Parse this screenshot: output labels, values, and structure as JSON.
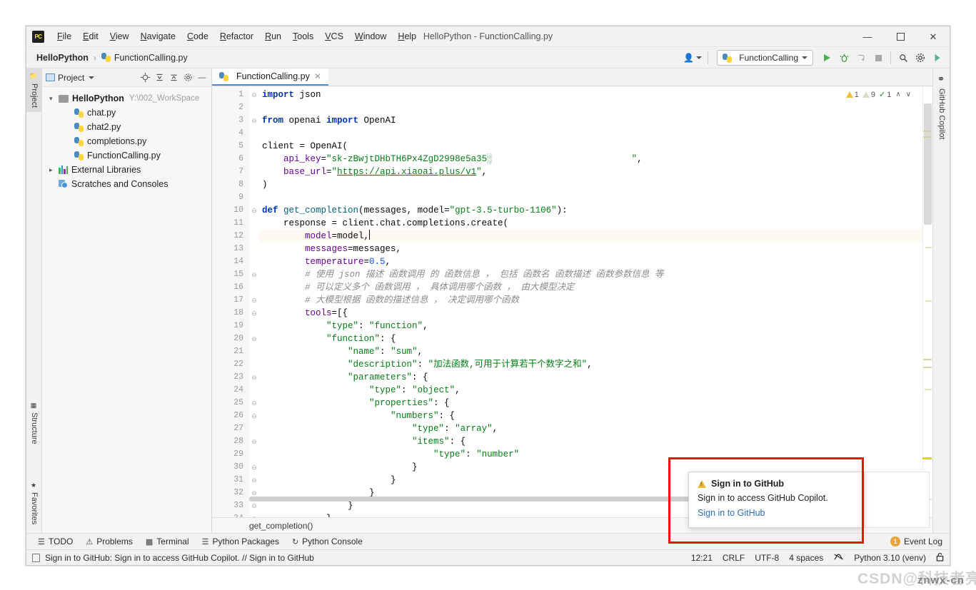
{
  "window": {
    "title": "HelloPython - FunctionCalling.py",
    "minimize": "—",
    "maximize": "❐",
    "close": "✕"
  },
  "menubar": {
    "logo": "PC",
    "items": [
      "File",
      "Edit",
      "View",
      "Navigate",
      "Code",
      "Refactor",
      "Run",
      "Tools",
      "VCS",
      "Window",
      "Help"
    ]
  },
  "breadcrumb": {
    "project": "HelloPython",
    "separator": "›",
    "file": "FunctionCalling.py"
  },
  "toolbar": {
    "account_icon": "person-icon",
    "run_config": "FunctionCalling",
    "run": "run-icon",
    "debug": "debug-icon",
    "coverage": "coverage-icon",
    "stop": "stop-icon",
    "search": "⚲",
    "settings": "⚙",
    "updates": "◖"
  },
  "left_strip": {
    "project": "Project",
    "structure": "Structure",
    "favorites": "Favorites"
  },
  "right_strip": {
    "copilot": "GitHub Copilot"
  },
  "project_panel": {
    "title": "Project",
    "icons": [
      "locate-icon",
      "expand-all-icon",
      "collapse-all-icon",
      "gear-icon",
      "hide-icon"
    ],
    "tree": [
      {
        "label": "HelloPython",
        "path": "Y:\\002_WorkSpace",
        "type": "folder",
        "indent": 0,
        "expanded": true,
        "bold": true
      },
      {
        "label": "chat.py",
        "path": "",
        "type": "py",
        "indent": 1,
        "expanded": null,
        "bold": false
      },
      {
        "label": "chat2.py",
        "path": "",
        "type": "py",
        "indent": 1,
        "expanded": null,
        "bold": false
      },
      {
        "label": "completions.py",
        "path": "",
        "type": "py",
        "indent": 1,
        "expanded": null,
        "bold": false
      },
      {
        "label": "FunctionCalling.py",
        "path": "",
        "type": "py",
        "indent": 1,
        "expanded": null,
        "bold": false
      },
      {
        "label": "External Libraries",
        "path": "",
        "type": "lib",
        "indent": 0,
        "expanded": false,
        "bold": false
      },
      {
        "label": "Scratches and Consoles",
        "path": "",
        "type": "scratch",
        "indent": 0,
        "expanded": null,
        "bold": false
      }
    ]
  },
  "editor": {
    "tab": {
      "label": "FunctionCalling.py",
      "close": "✕"
    },
    "inspections": {
      "warnings": "1",
      "weak_warnings": "9",
      "checks": "1",
      "up": "∧",
      "down": "∨"
    },
    "caret_line": 12,
    "breadcrumb": "get_completion()",
    "lines": [
      {
        "n": 1,
        "fold": "⊖",
        "tokens": [
          {
            "t": "import",
            "c": "kw"
          },
          {
            "t": " json",
            "c": ""
          }
        ]
      },
      {
        "n": 2,
        "fold": "",
        "tokens": []
      },
      {
        "n": 3,
        "fold": "⊖",
        "tokens": [
          {
            "t": "from",
            "c": "kw"
          },
          {
            "t": " openai ",
            "c": ""
          },
          {
            "t": "import",
            "c": "kw"
          },
          {
            "t": " OpenAI",
            "c": ""
          }
        ]
      },
      {
        "n": 4,
        "fold": "",
        "tokens": []
      },
      {
        "n": 5,
        "fold": "",
        "tokens": [
          {
            "t": "client = OpenAI(",
            "c": ""
          }
        ]
      },
      {
        "n": 6,
        "fold": "",
        "tokens": [
          {
            "t": "    ",
            "c": ""
          },
          {
            "t": "api_key",
            "c": "param"
          },
          {
            "t": "=",
            "c": ""
          },
          {
            "t": "\"sk-zBwjtDHbTH6Px4ZgD2998e5a35░",
            "c": "str"
          },
          {
            "t": "                          \"",
            "c": "str"
          },
          {
            "t": ",",
            "c": ""
          }
        ]
      },
      {
        "n": 7,
        "fold": "",
        "tokens": [
          {
            "t": "    ",
            "c": ""
          },
          {
            "t": "base_url",
            "c": "param"
          },
          {
            "t": "=",
            "c": ""
          },
          {
            "t": "\"",
            "c": "str"
          },
          {
            "t": "https://api.xiaoai.plus/v1",
            "c": "link"
          },
          {
            "t": "\"",
            "c": "str"
          },
          {
            "t": ",",
            "c": ""
          }
        ]
      },
      {
        "n": 8,
        "fold": "",
        "tokens": [
          {
            "t": ")",
            "c": ""
          }
        ]
      },
      {
        "n": 9,
        "fold": "",
        "tokens": []
      },
      {
        "n": 10,
        "fold": "⊖",
        "tokens": [
          {
            "t": "def",
            "c": "kw"
          },
          {
            "t": " ",
            "c": ""
          },
          {
            "t": "get_completion",
            "c": "fn"
          },
          {
            "t": "(messages, model=",
            "c": ""
          },
          {
            "t": "\"gpt-3.5-turbo-1106\"",
            "c": "str"
          },
          {
            "t": "):",
            "c": ""
          }
        ]
      },
      {
        "n": 11,
        "fold": "",
        "tokens": [
          {
            "t": "    response = client.chat.completions.create(",
            "c": ""
          }
        ]
      },
      {
        "n": 12,
        "fold": "",
        "tokens": [
          {
            "t": "        ",
            "c": ""
          },
          {
            "t": "model",
            "c": "param"
          },
          {
            "t": "=model,",
            "c": ""
          },
          {
            "t": "|",
            "c": "caret"
          }
        ]
      },
      {
        "n": 13,
        "fold": "",
        "tokens": [
          {
            "t": "        ",
            "c": ""
          },
          {
            "t": "messages",
            "c": "param"
          },
          {
            "t": "=messages,",
            "c": ""
          }
        ]
      },
      {
        "n": 14,
        "fold": "",
        "tokens": [
          {
            "t": "        ",
            "c": ""
          },
          {
            "t": "temperature",
            "c": "param"
          },
          {
            "t": "=",
            "c": ""
          },
          {
            "t": "0.5",
            "c": "num"
          },
          {
            "t": ",",
            "c": ""
          }
        ]
      },
      {
        "n": 15,
        "fold": "⊖",
        "tokens": [
          {
            "t": "        # 使用 json 描述 函数调用 的 函数信息 ， 包括 函数名 函数描述 函数参数信息 等",
            "c": "cmt"
          }
        ]
      },
      {
        "n": 16,
        "fold": "",
        "tokens": [
          {
            "t": "        # 可以定义多个 函数调用 ， 具体调用哪个函数 ， 由大模型决定",
            "c": "cmt"
          }
        ]
      },
      {
        "n": 17,
        "fold": "⊖",
        "tokens": [
          {
            "t": "        # 大模型根据 函数的描述信息 ， 决定调用哪个函数",
            "c": "cmt"
          }
        ]
      },
      {
        "n": 18,
        "fold": "⊖",
        "tokens": [
          {
            "t": "        ",
            "c": ""
          },
          {
            "t": "tools",
            "c": "param"
          },
          {
            "t": "=[{",
            "c": ""
          }
        ]
      },
      {
        "n": 19,
        "fold": "",
        "tokens": [
          {
            "t": "            ",
            "c": ""
          },
          {
            "t": "\"type\"",
            "c": "str"
          },
          {
            "t": ": ",
            "c": ""
          },
          {
            "t": "\"function\"",
            "c": "str"
          },
          {
            "t": ",",
            "c": ""
          }
        ]
      },
      {
        "n": 20,
        "fold": "⊖",
        "tokens": [
          {
            "t": "            ",
            "c": ""
          },
          {
            "t": "\"function\"",
            "c": "str"
          },
          {
            "t": ": {",
            "c": ""
          }
        ]
      },
      {
        "n": 21,
        "fold": "",
        "tokens": [
          {
            "t": "                ",
            "c": ""
          },
          {
            "t": "\"name\"",
            "c": "str"
          },
          {
            "t": ": ",
            "c": ""
          },
          {
            "t": "\"sum\"",
            "c": "str"
          },
          {
            "t": ",",
            "c": ""
          }
        ]
      },
      {
        "n": 22,
        "fold": "",
        "tokens": [
          {
            "t": "                ",
            "c": ""
          },
          {
            "t": "\"description\"",
            "c": "str"
          },
          {
            "t": ": ",
            "c": ""
          },
          {
            "t": "\"加法函数,可用于计算若干个数字之和\"",
            "c": "str"
          },
          {
            "t": ",",
            "c": ""
          }
        ]
      },
      {
        "n": 23,
        "fold": "⊖",
        "tokens": [
          {
            "t": "                ",
            "c": ""
          },
          {
            "t": "\"parameters\"",
            "c": "str"
          },
          {
            "t": ": {",
            "c": ""
          }
        ]
      },
      {
        "n": 24,
        "fold": "",
        "tokens": [
          {
            "t": "                    ",
            "c": ""
          },
          {
            "t": "\"type\"",
            "c": "str"
          },
          {
            "t": ": ",
            "c": ""
          },
          {
            "t": "\"object\"",
            "c": "str"
          },
          {
            "t": ",",
            "c": ""
          }
        ]
      },
      {
        "n": 25,
        "fold": "⊖",
        "tokens": [
          {
            "t": "                    ",
            "c": ""
          },
          {
            "t": "\"properties\"",
            "c": "str"
          },
          {
            "t": ": {",
            "c": ""
          }
        ]
      },
      {
        "n": 26,
        "fold": "⊖",
        "tokens": [
          {
            "t": "                        ",
            "c": ""
          },
          {
            "t": "\"numbers\"",
            "c": "str"
          },
          {
            "t": ": {",
            "c": ""
          }
        ]
      },
      {
        "n": 27,
        "fold": "",
        "tokens": [
          {
            "t": "                            ",
            "c": ""
          },
          {
            "t": "\"type\"",
            "c": "str"
          },
          {
            "t": ": ",
            "c": ""
          },
          {
            "t": "\"array\"",
            "c": "str"
          },
          {
            "t": ",",
            "c": ""
          }
        ]
      },
      {
        "n": 28,
        "fold": "⊖",
        "tokens": [
          {
            "t": "                            ",
            "c": ""
          },
          {
            "t": "\"items\"",
            "c": "str"
          },
          {
            "t": ": {",
            "c": ""
          }
        ]
      },
      {
        "n": 29,
        "fold": "",
        "tokens": [
          {
            "t": "                                ",
            "c": ""
          },
          {
            "t": "\"type\"",
            "c": "str"
          },
          {
            "t": ": ",
            "c": ""
          },
          {
            "t": "\"number\"",
            "c": "str"
          }
        ]
      },
      {
        "n": 30,
        "fold": "⊖",
        "tokens": [
          {
            "t": "                            }",
            "c": ""
          }
        ]
      },
      {
        "n": 31,
        "fold": "⊖",
        "tokens": [
          {
            "t": "                        }",
            "c": ""
          }
        ]
      },
      {
        "n": 32,
        "fold": "⊖",
        "tokens": [
          {
            "t": "                    }",
            "c": ""
          }
        ]
      },
      {
        "n": 33,
        "fold": "⊖",
        "tokens": [
          {
            "t": "                }",
            "c": ""
          }
        ]
      },
      {
        "n": 34,
        "fold": "⊖",
        "tokens": [
          {
            "t": "            }",
            "c": ""
          }
        ]
      }
    ]
  },
  "copilot_popup": {
    "title": "Sign in to GitHub",
    "body": "Sign in to access GitHub Copilot.",
    "link": "Sign in to GitHub"
  },
  "bottom_tools": [
    {
      "label": "TODO",
      "icon": "todo-icon"
    },
    {
      "label": "Problems",
      "icon": "problems-icon"
    },
    {
      "label": "Terminal",
      "icon": "terminal-icon"
    },
    {
      "label": "Python Packages",
      "icon": "packages-icon"
    },
    {
      "label": "Python Console",
      "icon": "console-icon"
    }
  ],
  "event_log": {
    "label": "Event Log",
    "count": "1"
  },
  "statusbar": {
    "message": "Sign in to GitHub: Sign in to access GitHub Copilot. // Sign in to GitHub",
    "position": "12:21",
    "line_sep": "CRLF",
    "encoding": "UTF-8",
    "indent": "4 spaces",
    "branch_icon": "vcs-icon",
    "interpreter": "Python 3.10 (venv)",
    "lock_icon": "lock-icon"
  },
  "watermark": {
    "main": "CSDN@科技者亮",
    "over": "znwx-cn"
  },
  "colors": {
    "accent_blue": "#4a90d9",
    "keyword": "#0033b3",
    "string": "#067d17",
    "number": "#1750eb",
    "comment": "#8c8c8c",
    "param": "#660099",
    "function": "#00627a",
    "warning": "#e8c33a",
    "red_highlight": "#f40f0f"
  }
}
